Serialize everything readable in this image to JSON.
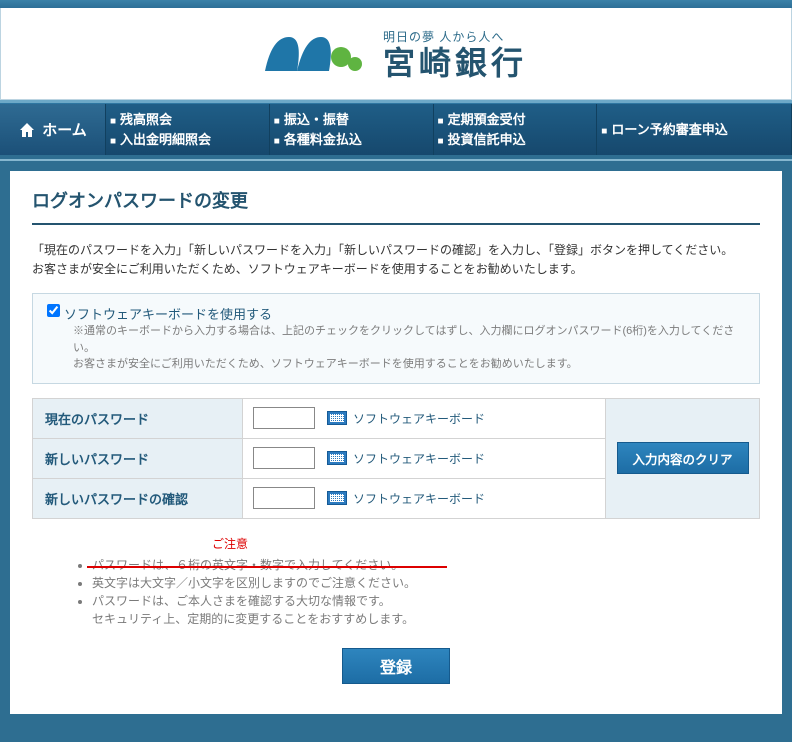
{
  "logo": {
    "tagline": "明日の夢 人から人へ",
    "bank_name": "宮崎銀行"
  },
  "nav": {
    "home": "ホーム",
    "col1": [
      "残高照会",
      "入出金明細照会"
    ],
    "col2": [
      "振込・振替",
      "各種料金払込"
    ],
    "col3": [
      "定期預金受付",
      "投資信託申込"
    ],
    "col4": [
      "ローン予約審査申込"
    ]
  },
  "page_title": "ログオンパスワードの変更",
  "instructions": {
    "line1": "「現在のパスワードを入力」「新しいパスワードを入力」「新しいパスワードの確認」を入力し、「登録」ボタンを押してください。",
    "line2": "お客さまが安全にご利用いただくため、ソフトウェアキーボードを使用することをお勧めいたします。"
  },
  "software_kb": {
    "label": "ソフトウェアキーボードを使用する",
    "note1": "通常のキーボードから入力する場合は、上記のチェックをクリックしてはずし、入力欄にログオンパスワード(6桁)を入力してください。",
    "note2": "お客さまが安全にご利用いただくため、ソフトウェアキーボードを使用することをお勧めいたします。"
  },
  "fields": {
    "current": "現在のパスワード",
    "new": "新しいパスワード",
    "confirm": "新しいパスワードの確認",
    "swkb_label": "ソフトウェアキーボード"
  },
  "buttons": {
    "clear": "入力内容のクリア",
    "register": "登録"
  },
  "notice": {
    "heading": "ご注意",
    "items": [
      "パスワードは、６桁の英文字・数字で入力してください。",
      "英文字は大文字／小文字を区別しますのでご注意ください。",
      "パスワードは、ご本人さまを確認する大切な情報です。",
      "セキュリティ上、定期的に変更することをおすすめします。"
    ]
  }
}
